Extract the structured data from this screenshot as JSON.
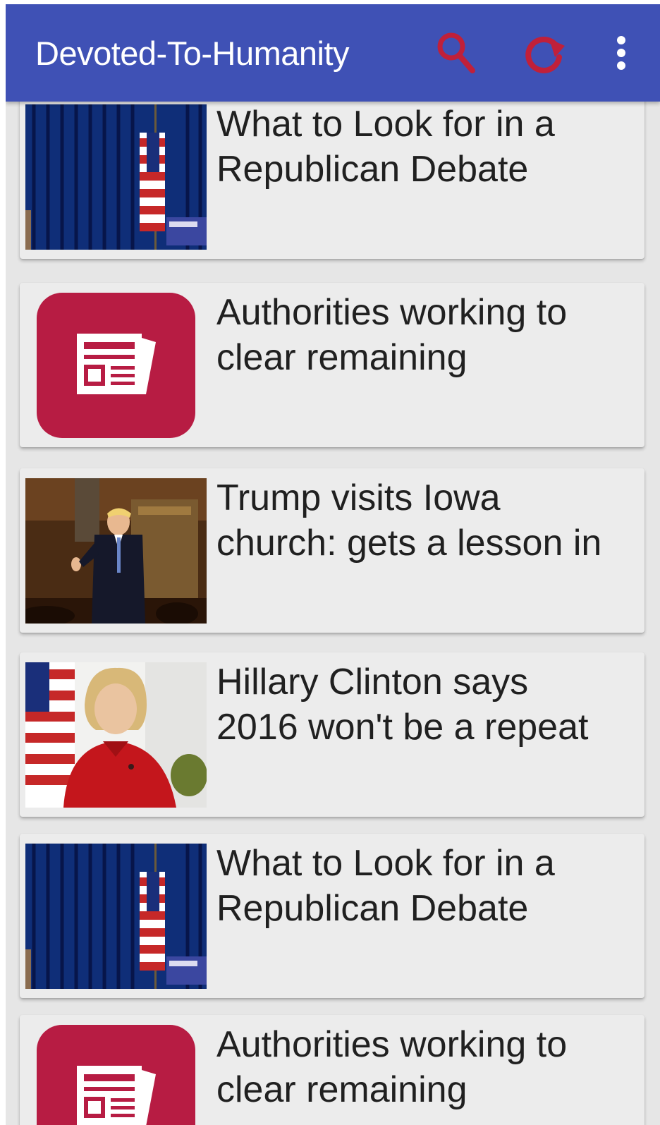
{
  "app_bar": {
    "title": "Devoted-To-Humanity",
    "icons": [
      "search-icon",
      "refresh-icon",
      "more-vert-icon"
    ],
    "accent_color": "#3f51b5",
    "icon_color": "#c0203a"
  },
  "feed": {
    "items": [
      {
        "title_line1": "What to Look for in a",
        "title_line2": "Republican Debate",
        "thumbnail": "debate-stage-photo"
      },
      {
        "title_line1": "Authorities working to",
        "title_line2": "clear remaining",
        "thumbnail": "newspaper-icon"
      },
      {
        "title_line1": "Trump visits Iowa",
        "title_line2": "church: gets a lesson in",
        "thumbnail": "church-photo"
      },
      {
        "title_line1": "Hillary Clinton says",
        "title_line2": "2016 won't be a repeat",
        "thumbnail": "clinton-photo"
      },
      {
        "title_line1": "What to Look for in a",
        "title_line2": "Republican Debate",
        "thumbnail": "debate-stage-photo"
      },
      {
        "title_line1": "Authorities working to",
        "title_line2": "clear remaining",
        "thumbnail": "newspaper-icon"
      }
    ]
  }
}
